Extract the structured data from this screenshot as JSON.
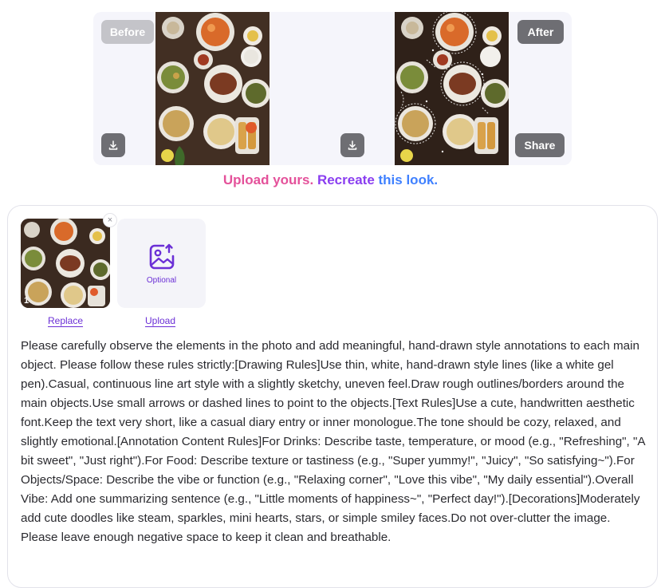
{
  "compare": {
    "before_label": "Before",
    "after_label": "After",
    "share_label": "Share",
    "icons": {
      "download": "download-icon"
    }
  },
  "cta": {
    "part1": "Upload yours.",
    "part2": "Recreate",
    "part3": "this look."
  },
  "editor": {
    "thumbnail_index": "1",
    "remove_symbol": "×",
    "upload_optional": "Optional",
    "replace_label": "Replace",
    "upload_label": "Upload",
    "icons": {
      "upload": "image-upload-icon",
      "remove": "close-icon"
    },
    "prompt_text": "Please carefully observe the elements in the photo and add meaningful, hand-drawn style annotations to each main object. Please follow these rules strictly:[Drawing Rules]Use thin, white, hand-drawn style lines (like a white gel pen).Casual, continuous line art style with a slightly sketchy, uneven feel.Draw rough outlines/borders around the main objects.Use small arrows or dashed lines to point to the objects.[Text Rules]Use a cute, handwritten aesthetic font.Keep the text very short, like a casual diary entry or inner monologue.The tone should be cozy, relaxed, and slightly emotional.[Annotation Content Rules]For Drinks: Describe taste, temperature, or mood (e.g., \"Refreshing\", \"A bit sweet\", \"Just right\").For Food: Describe texture or tastiness (e.g., \"Super yummy!\", \"Juicy\", \"So satisfying~\").For Objects/Space: Describe the vibe or function (e.g., \"Relaxing corner\", \"Love this vibe\", \"My daily essential\").Overall Vibe: Add one summarizing sentence (e.g., \"Little moments of happiness~\", \"Perfect day!\").[Decorations]Moderately add cute doodles like steam, sparkles, mini hearts, stars, or simple smiley faces.Do not over-clutter the image. Please leave enough negative space to keep it clean and breathable."
  }
}
